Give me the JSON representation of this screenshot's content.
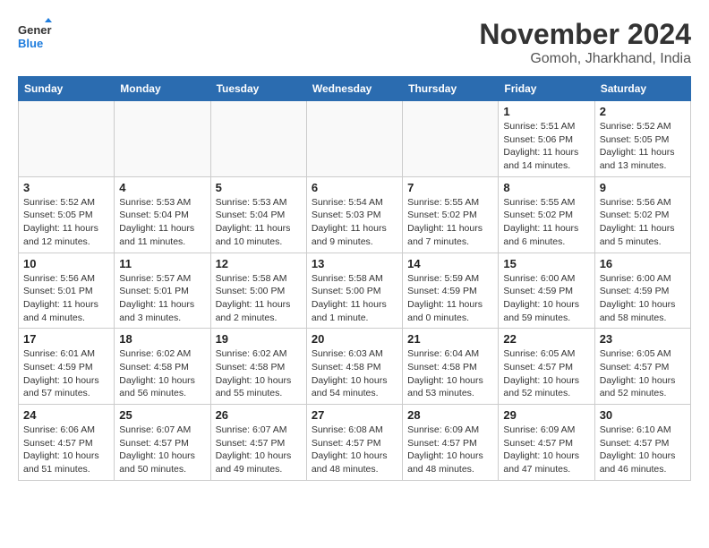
{
  "header": {
    "logo_general": "General",
    "logo_blue": "Blue",
    "month": "November 2024",
    "location": "Gomoh, Jharkhand, India"
  },
  "weekdays": [
    "Sunday",
    "Monday",
    "Tuesday",
    "Wednesday",
    "Thursday",
    "Friday",
    "Saturday"
  ],
  "weeks": [
    [
      {
        "day": "",
        "info": ""
      },
      {
        "day": "",
        "info": ""
      },
      {
        "day": "",
        "info": ""
      },
      {
        "day": "",
        "info": ""
      },
      {
        "day": "",
        "info": ""
      },
      {
        "day": "1",
        "info": "Sunrise: 5:51 AM\nSunset: 5:06 PM\nDaylight: 11 hours and 14 minutes."
      },
      {
        "day": "2",
        "info": "Sunrise: 5:52 AM\nSunset: 5:05 PM\nDaylight: 11 hours and 13 minutes."
      }
    ],
    [
      {
        "day": "3",
        "info": "Sunrise: 5:52 AM\nSunset: 5:05 PM\nDaylight: 11 hours and 12 minutes."
      },
      {
        "day": "4",
        "info": "Sunrise: 5:53 AM\nSunset: 5:04 PM\nDaylight: 11 hours and 11 minutes."
      },
      {
        "day": "5",
        "info": "Sunrise: 5:53 AM\nSunset: 5:04 PM\nDaylight: 11 hours and 10 minutes."
      },
      {
        "day": "6",
        "info": "Sunrise: 5:54 AM\nSunset: 5:03 PM\nDaylight: 11 hours and 9 minutes."
      },
      {
        "day": "7",
        "info": "Sunrise: 5:55 AM\nSunset: 5:02 PM\nDaylight: 11 hours and 7 minutes."
      },
      {
        "day": "8",
        "info": "Sunrise: 5:55 AM\nSunset: 5:02 PM\nDaylight: 11 hours and 6 minutes."
      },
      {
        "day": "9",
        "info": "Sunrise: 5:56 AM\nSunset: 5:02 PM\nDaylight: 11 hours and 5 minutes."
      }
    ],
    [
      {
        "day": "10",
        "info": "Sunrise: 5:56 AM\nSunset: 5:01 PM\nDaylight: 11 hours and 4 minutes."
      },
      {
        "day": "11",
        "info": "Sunrise: 5:57 AM\nSunset: 5:01 PM\nDaylight: 11 hours and 3 minutes."
      },
      {
        "day": "12",
        "info": "Sunrise: 5:58 AM\nSunset: 5:00 PM\nDaylight: 11 hours and 2 minutes."
      },
      {
        "day": "13",
        "info": "Sunrise: 5:58 AM\nSunset: 5:00 PM\nDaylight: 11 hours and 1 minute."
      },
      {
        "day": "14",
        "info": "Sunrise: 5:59 AM\nSunset: 4:59 PM\nDaylight: 11 hours and 0 minutes."
      },
      {
        "day": "15",
        "info": "Sunrise: 6:00 AM\nSunset: 4:59 PM\nDaylight: 10 hours and 59 minutes."
      },
      {
        "day": "16",
        "info": "Sunrise: 6:00 AM\nSunset: 4:59 PM\nDaylight: 10 hours and 58 minutes."
      }
    ],
    [
      {
        "day": "17",
        "info": "Sunrise: 6:01 AM\nSunset: 4:59 PM\nDaylight: 10 hours and 57 minutes."
      },
      {
        "day": "18",
        "info": "Sunrise: 6:02 AM\nSunset: 4:58 PM\nDaylight: 10 hours and 56 minutes."
      },
      {
        "day": "19",
        "info": "Sunrise: 6:02 AM\nSunset: 4:58 PM\nDaylight: 10 hours and 55 minutes."
      },
      {
        "day": "20",
        "info": "Sunrise: 6:03 AM\nSunset: 4:58 PM\nDaylight: 10 hours and 54 minutes."
      },
      {
        "day": "21",
        "info": "Sunrise: 6:04 AM\nSunset: 4:58 PM\nDaylight: 10 hours and 53 minutes."
      },
      {
        "day": "22",
        "info": "Sunrise: 6:05 AM\nSunset: 4:57 PM\nDaylight: 10 hours and 52 minutes."
      },
      {
        "day": "23",
        "info": "Sunrise: 6:05 AM\nSunset: 4:57 PM\nDaylight: 10 hours and 52 minutes."
      }
    ],
    [
      {
        "day": "24",
        "info": "Sunrise: 6:06 AM\nSunset: 4:57 PM\nDaylight: 10 hours and 51 minutes."
      },
      {
        "day": "25",
        "info": "Sunrise: 6:07 AM\nSunset: 4:57 PM\nDaylight: 10 hours and 50 minutes."
      },
      {
        "day": "26",
        "info": "Sunrise: 6:07 AM\nSunset: 4:57 PM\nDaylight: 10 hours and 49 minutes."
      },
      {
        "day": "27",
        "info": "Sunrise: 6:08 AM\nSunset: 4:57 PM\nDaylight: 10 hours and 48 minutes."
      },
      {
        "day": "28",
        "info": "Sunrise: 6:09 AM\nSunset: 4:57 PM\nDaylight: 10 hours and 48 minutes."
      },
      {
        "day": "29",
        "info": "Sunrise: 6:09 AM\nSunset: 4:57 PM\nDaylight: 10 hours and 47 minutes."
      },
      {
        "day": "30",
        "info": "Sunrise: 6:10 AM\nSunset: 4:57 PM\nDaylight: 10 hours and 46 minutes."
      }
    ]
  ]
}
